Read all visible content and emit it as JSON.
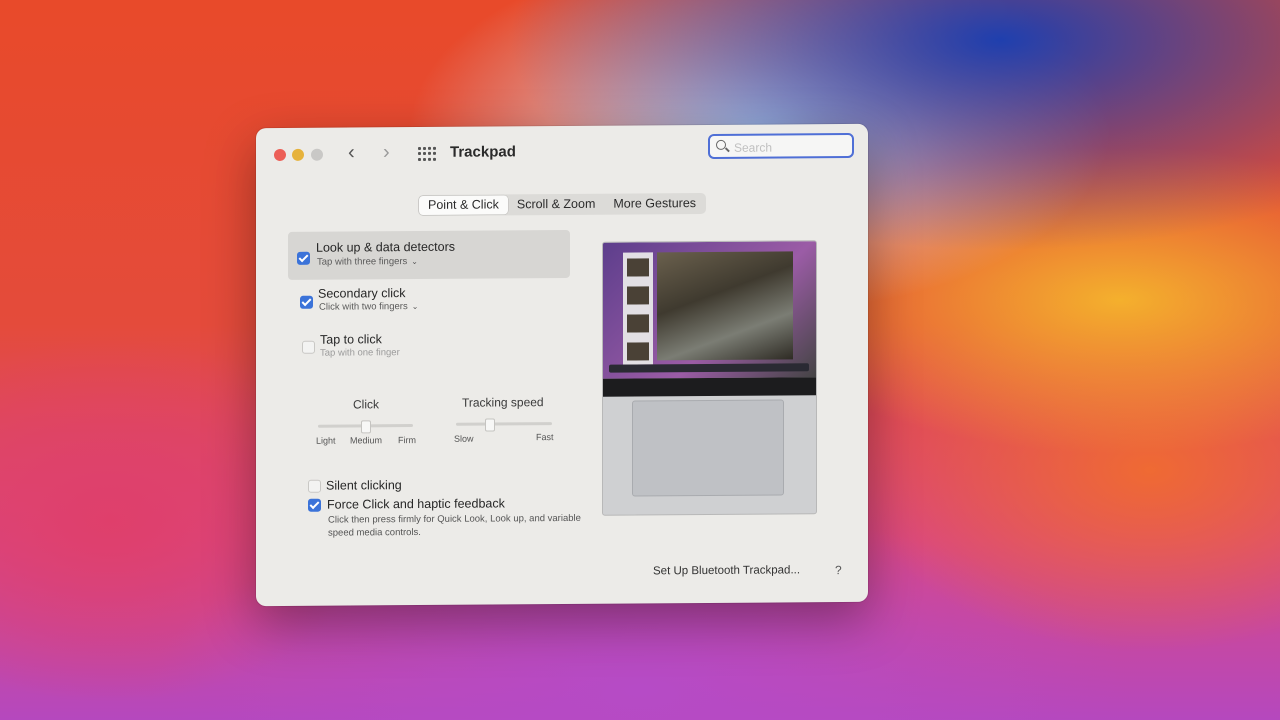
{
  "window": {
    "title": "Trackpad",
    "back_glyph": "‹",
    "forward_glyph": "›",
    "search_placeholder": "Search"
  },
  "tabs": [
    {
      "label": "Point & Click",
      "active": true
    },
    {
      "label": "Scroll & Zoom",
      "active": false
    },
    {
      "label": "More Gestures",
      "active": false
    }
  ],
  "options": {
    "lookup": {
      "label": "Look up & data detectors",
      "sub": "Tap with three fingers",
      "checked": true
    },
    "secondary": {
      "label": "Secondary click",
      "sub": "Click with two fingers",
      "checked": true
    },
    "tap": {
      "label": "Tap to click",
      "sub": "Tap with one finger",
      "checked": false
    },
    "silent": {
      "label": "Silent clicking",
      "checked": false
    },
    "force": {
      "label": "Force Click and haptic feedback",
      "checked": true,
      "desc": "Click then press firmly for Quick Look, Look up, and variable speed media controls."
    }
  },
  "sliders": {
    "click": {
      "title": "Click",
      "min_label": "Light",
      "mid_label": "Medium",
      "max_label": "Firm"
    },
    "tracking": {
      "title": "Tracking speed",
      "min_label": "Slow",
      "max_label": "Fast"
    }
  },
  "footer": {
    "bt_button": "Set Up Bluetooth Trackpad...",
    "help": "?"
  },
  "colors": {
    "accent": "#3b73d9",
    "search_focus": "#4f6fd6"
  }
}
